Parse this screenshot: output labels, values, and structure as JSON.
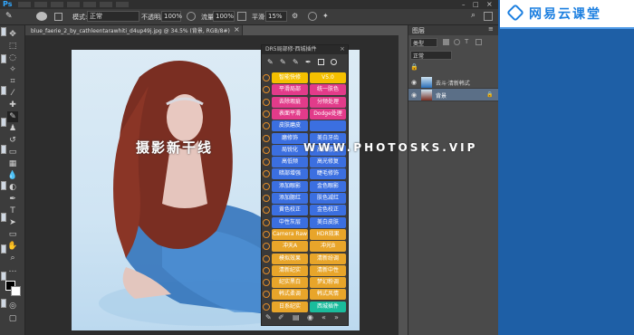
{
  "app": {
    "logo": "Ps",
    "menu": [
      "",
      "",
      "",
      "",
      "",
      "",
      "",
      "",
      "",
      "",
      ""
    ]
  },
  "options_bar": {
    "mode_label": "模式:",
    "mode_value": "正常",
    "opacity_label": "不透明度:",
    "opacity_value": "100%",
    "flow_label": "流量:",
    "flow_value": "100%",
    "smoothing_label": "平滑:",
    "smoothing_value": "15%"
  },
  "document_tab": {
    "title": "blue_faerie_2_by_cathleentarawhiti_d4up49j.jpg @ 34.5% (背景, RGB/8#)",
    "close": "×"
  },
  "plugin_panel": {
    "title": "DR5局部修·西城插件",
    "buttons_left": [
      {
        "label": "智能快修",
        "color": "#f5c000"
      },
      {
        "label": "平滑局部",
        "color": "#e23b8a"
      },
      {
        "label": "去除瑕疵",
        "color": "#e23b8a"
      },
      {
        "label": "表面平滑",
        "color": "#e23b8a"
      },
      {
        "label": "皮肤磨皮",
        "color": "#3b6fe0"
      },
      {
        "label": "磨修饰",
        "color": "#3b6fe0"
      },
      {
        "label": "局锐化",
        "color": "#3b6fe0"
      },
      {
        "label": "高低频",
        "color": "#3b6fe0"
      },
      {
        "label": "暗部增强",
        "color": "#3b6fe0"
      },
      {
        "label": "添加眼影",
        "color": "#3b6fe0"
      },
      {
        "label": "添加腮红",
        "color": "#3b6fe0"
      },
      {
        "label": "黄色校正",
        "color": "#3b6fe0"
      },
      {
        "label": "中性灰层",
        "color": "#3b6fe0"
      },
      {
        "label": "Camera Raw",
        "color": "#e8a52a"
      },
      {
        "label": "冲天A",
        "color": "#e8a52a"
      },
      {
        "label": "模拟效果",
        "color": "#e8a52a"
      },
      {
        "label": "清新纪实",
        "color": "#e8a52a"
      },
      {
        "label": "纪实黑白",
        "color": "#e8a52a"
      },
      {
        "label": "韩式柔调",
        "color": "#e8a52a"
      },
      {
        "label": "日系纪实",
        "color": "#e8a52a"
      }
    ],
    "buttons_right": [
      {
        "label": "V5.0",
        "color": "#f5c000"
      },
      {
        "label": "统一肤色",
        "color": "#e23b8a"
      },
      {
        "label": "分频处理",
        "color": "#e23b8a"
      },
      {
        "label": "Dodge处理",
        "color": "#e23b8a"
      },
      {
        "label": "",
        "color": "#3b6fe0"
      },
      {
        "label": "美白牙齿",
        "color": "#3b6fe0"
      },
      {
        "label": "高光修复",
        "color": "#3b6fe0"
      },
      {
        "label": "高光修复",
        "color": "#3b6fe0"
      },
      {
        "label": "睫毛修饰",
        "color": "#3b6fe0"
      },
      {
        "label": "金色眼影",
        "color": "#3b6fe0"
      },
      {
        "label": "肤色减红",
        "color": "#3b6fe0"
      },
      {
        "label": "金色校正",
        "color": "#3b6fe0"
      },
      {
        "label": "美白皮肤",
        "color": "#3b6fe0"
      },
      {
        "label": "HDR效果",
        "color": "#e8a52a"
      },
      {
        "label": "冲光B",
        "color": "#e8a52a"
      },
      {
        "label": "清新纷调",
        "color": "#e8a52a"
      },
      {
        "label": "清新中性",
        "color": "#e8a52a"
      },
      {
        "label": "梦幻粉调",
        "color": "#e8a52a"
      },
      {
        "label": "韩式风情",
        "color": "#e8a52a"
      },
      {
        "label": "西城插件",
        "color": "#1abc9c"
      }
    ],
    "footer_icons": [
      "pen-icon",
      "brush-icon",
      "layers-icon",
      "eye-icon",
      "back-icon",
      "forward-icon"
    ]
  },
  "watermark": {
    "text": "摄影新干线",
    "url": "WWW.PHOTOSKS.VIP"
  },
  "layers_panel": {
    "tab": "图层",
    "kind_label": "类型",
    "blend_mode": "正常",
    "layers": [
      {
        "name": "去斗·清新韩式"
      },
      {
        "name": "背景"
      }
    ]
  },
  "overlay": {
    "brand": "网易云课堂"
  }
}
